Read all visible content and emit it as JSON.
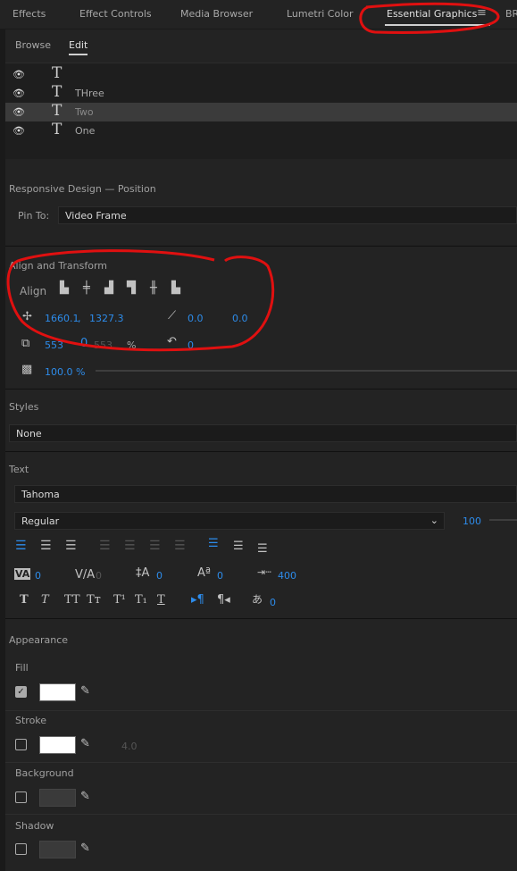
{
  "tabs": [
    "Effects",
    "Effect Controls",
    "Media Browser",
    "Lumetri Color",
    "Essential Graphics",
    "BR"
  ],
  "active_tab": "Essential Graphics",
  "menu_icon": "hamburger-icon",
  "subtabs": [
    "Browse",
    "Edit"
  ],
  "layers": [
    {
      "name": ""
    },
    {
      "name": "THree"
    },
    {
      "name": "Two",
      "selected": true
    },
    {
      "name": "One"
    }
  ],
  "responsive": {
    "title": "Responsive Design — Position",
    "pin_label": "Pin To:",
    "pin_value": "Video Frame"
  },
  "align": {
    "title": "Align and Transform",
    "align_label": "Align",
    "pos_x": "1660.1",
    "pos_y": "1327.3",
    "anchor_x": "0.0",
    "anchor_y": "0.0",
    "scale": "553",
    "scale_linked": "553",
    "scale_unit": "%",
    "rotation": "0",
    "opacity": "100.0 %"
  },
  "styles": {
    "title": "Styles",
    "value": "None"
  },
  "text": {
    "title": "Text",
    "font": "Tahoma",
    "style": "Regular",
    "size": "100",
    "tracking": "0",
    "kerning": "0",
    "leading": "0",
    "baseline": "0",
    "tabwidth": "400",
    "tsume": "0"
  },
  "appearance": {
    "title": "Appearance",
    "fill_label": "Fill",
    "fill_checked": true,
    "fill_color": "#ffffff",
    "stroke_label": "Stroke",
    "stroke_checked": false,
    "stroke_color": "#ffffff",
    "stroke_width": "4.0",
    "background_label": "Background",
    "background_checked": false,
    "background_color": "#3a3a3a",
    "shadow_label": "Shadow",
    "shadow_checked": false,
    "shadow_color": "#3a3a3a"
  },
  "colors": {
    "accent": "#2d8ceb",
    "annotation": "#e01010"
  }
}
